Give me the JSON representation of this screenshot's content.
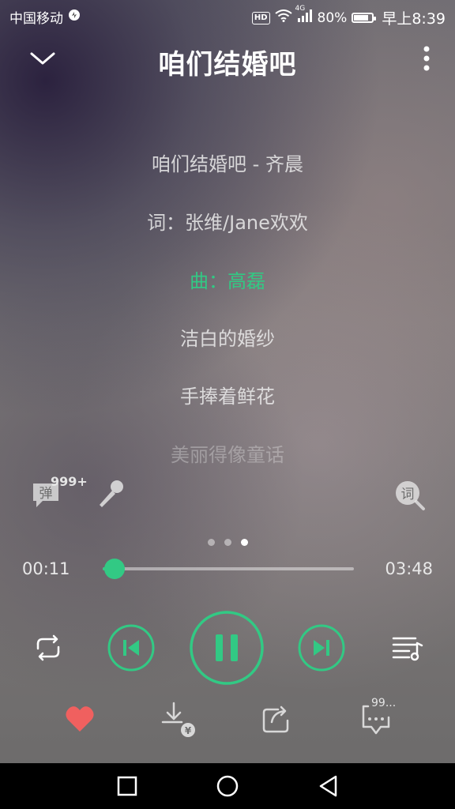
{
  "status_bar": {
    "carrier": "中国移动",
    "network": "4G",
    "hd": "HD",
    "battery": "80%",
    "battery_level": 0.8,
    "time": "早上8:39"
  },
  "header": {
    "title": "咱们结婚吧",
    "collapse_icon": "chevron-down-icon",
    "more_icon": "more-vertical-icon"
  },
  "lyrics": {
    "lines": [
      "咱们结婚吧 - 齐晨",
      "词：张维/Jane欢欢",
      "曲：高磊",
      "洁白的婚纱",
      "手捧着鲜花",
      "美丽得像童话"
    ],
    "active_index": 2
  },
  "side_actions": {
    "danmu_label": "弹",
    "danmu_count": "999+",
    "lyrics_search_label": "词"
  },
  "pager": {
    "count": 3,
    "active": 2
  },
  "progress": {
    "current": "00:11",
    "total": "03:48",
    "fraction": 0.048
  },
  "colors": {
    "accent": "#32c984",
    "heart": "#f0605f"
  },
  "actions": {
    "comment_count": "99..."
  }
}
